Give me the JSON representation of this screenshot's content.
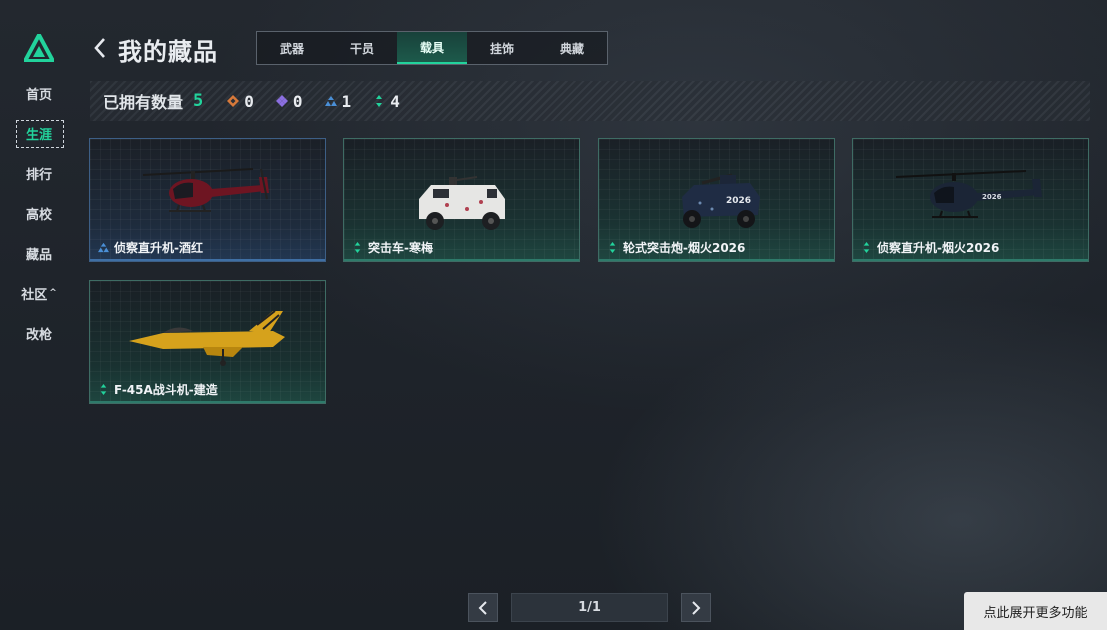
{
  "colors": {
    "accent": "#22d39c",
    "blue_rarity": "#4a8fd6",
    "orange_rarity": "#d7793a",
    "purple_rarity": "#8b6fe0"
  },
  "sidebar": {
    "logo_icon": "triangle-logo-icon",
    "items": [
      {
        "label": "首页",
        "active": false
      },
      {
        "label": "生涯",
        "active": true
      },
      {
        "label": "排行",
        "active": false
      },
      {
        "label": "高校",
        "active": false
      },
      {
        "label": "藏品",
        "active": false
      },
      {
        "label": "社区",
        "active": false,
        "caret": "^"
      },
      {
        "label": "改枪",
        "active": false
      }
    ]
  },
  "header": {
    "back_icon": "chevron-left-icon",
    "title": "我的藏品",
    "tabs": [
      {
        "label": "武器",
        "active": false
      },
      {
        "label": "干员",
        "active": false
      },
      {
        "label": "载具",
        "active": true
      },
      {
        "label": "挂饰",
        "active": false
      },
      {
        "label": "典藏",
        "active": false
      }
    ]
  },
  "stats": {
    "label": "已拥有数量",
    "total": "5",
    "counts": [
      {
        "icon": "orange-diamond-icon",
        "value": "0"
      },
      {
        "icon": "purple-diamond-icon",
        "value": "0"
      },
      {
        "icon": "blue-triangle-icon",
        "value": "1"
      },
      {
        "icon": "green-arrows-icon",
        "value": "4"
      }
    ]
  },
  "vehicles": [
    {
      "name": "侦察直升机-酒红",
      "rarity": "blue",
      "image": "helicopter-red-icon"
    },
    {
      "name": "突击车-寒梅",
      "rarity": "green",
      "image": "armored-truck-icon"
    },
    {
      "name": "轮式突击炮-烟火2026",
      "rarity": "green",
      "image": "wheeled-assault-gun-icon"
    },
    {
      "name": "侦察直升机-烟火2026",
      "rarity": "green",
      "image": "helicopter-dark-icon"
    },
    {
      "name": "F-45A战斗机-建造",
      "rarity": "green",
      "image": "fighter-jet-yellow-icon"
    }
  ],
  "pagination": {
    "page": "1/1",
    "prev_icon": "chevron-left-icon",
    "next_icon": "chevron-right-icon"
  },
  "expand_button": {
    "label": "点此展开更多功能"
  }
}
